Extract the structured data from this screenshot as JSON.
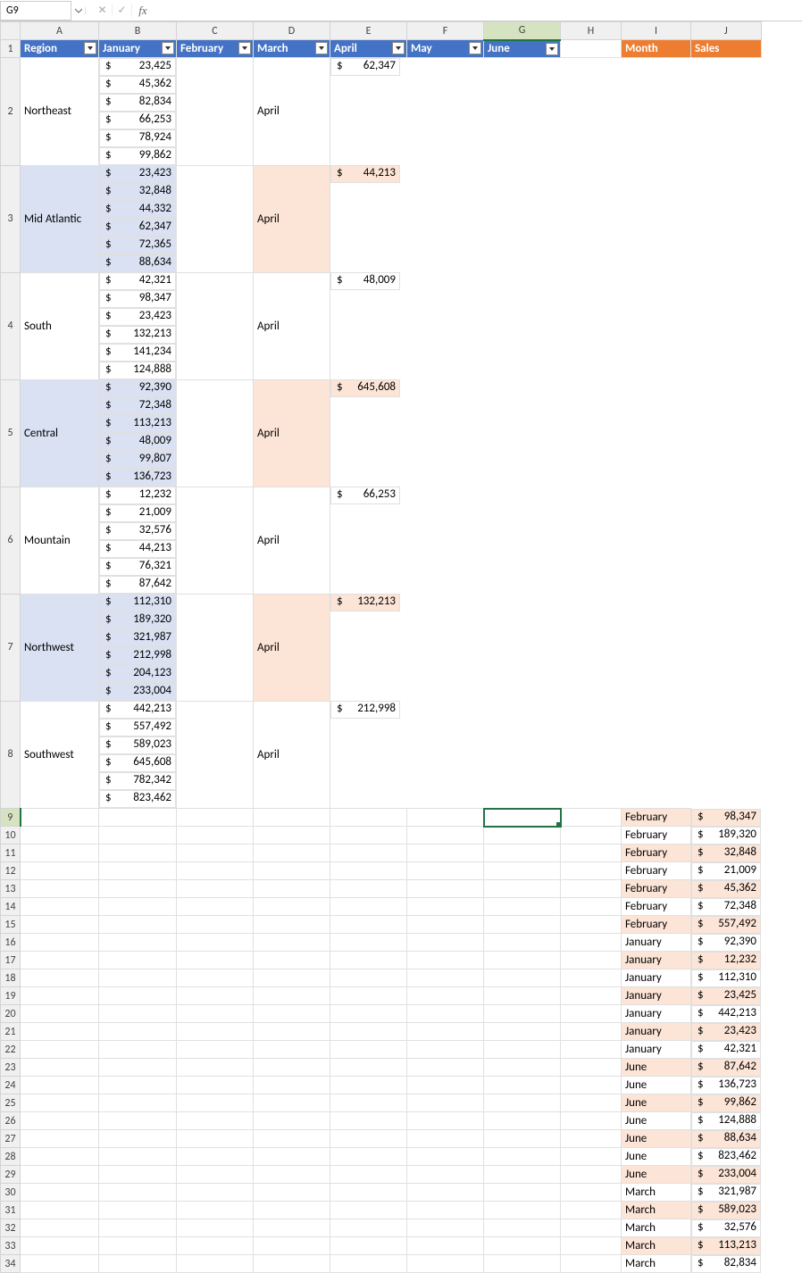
{
  "formula_bar": {
    "name_box": "G9",
    "fx_label": "fx",
    "formula": ""
  },
  "columns": [
    "A",
    "B",
    "C",
    "D",
    "E",
    "F",
    "G",
    "H",
    "I",
    "J"
  ],
  "row_count": 34,
  "selected_col": "G",
  "selected_row": 9,
  "table1": {
    "headers": [
      "Region",
      "January",
      "February",
      "March",
      "April",
      "May",
      "June"
    ],
    "rows": [
      {
        "region": "Northeast",
        "vals": [
          "23,425",
          "45,362",
          "82,834",
          "66,253",
          "78,924",
          "99,862"
        ]
      },
      {
        "region": "Mid Atlantic",
        "vals": [
          "23,423",
          "32,848",
          "44,332",
          "62,347",
          "72,365",
          "88,634"
        ]
      },
      {
        "region": "South",
        "vals": [
          "42,321",
          "98,347",
          "23,423",
          "132,213",
          "141,234",
          "124,888"
        ]
      },
      {
        "region": "Central",
        "vals": [
          "92,390",
          "72,348",
          "113,213",
          "48,009",
          "99,807",
          "136,723"
        ]
      },
      {
        "region": "Mountain",
        "vals": [
          "12,232",
          "21,009",
          "32,576",
          "44,213",
          "76,321",
          "87,642"
        ]
      },
      {
        "region": "Northwest",
        "vals": [
          "112,310",
          "189,320",
          "321,987",
          "212,998",
          "204,123",
          "233,004"
        ]
      },
      {
        "region": "Southwest",
        "vals": [
          "442,213",
          "557,492",
          "589,023",
          "645,608",
          "782,342",
          "823,462"
        ]
      }
    ]
  },
  "table2": {
    "headers": [
      "Month",
      "Sales"
    ],
    "rows": [
      {
        "month": "April",
        "sales": "62,347"
      },
      {
        "month": "April",
        "sales": "44,213"
      },
      {
        "month": "April",
        "sales": "48,009"
      },
      {
        "month": "April",
        "sales": "645,608"
      },
      {
        "month": "April",
        "sales": "66,253"
      },
      {
        "month": "April",
        "sales": "132,213"
      },
      {
        "month": "April",
        "sales": "212,998"
      },
      {
        "month": "February",
        "sales": "98,347"
      },
      {
        "month": "February",
        "sales": "189,320"
      },
      {
        "month": "February",
        "sales": "32,848"
      },
      {
        "month": "February",
        "sales": "21,009"
      },
      {
        "month": "February",
        "sales": "45,362"
      },
      {
        "month": "February",
        "sales": "72,348"
      },
      {
        "month": "February",
        "sales": "557,492"
      },
      {
        "month": "January",
        "sales": "92,390"
      },
      {
        "month": "January",
        "sales": "12,232"
      },
      {
        "month": "January",
        "sales": "112,310"
      },
      {
        "month": "January",
        "sales": "23,425"
      },
      {
        "month": "January",
        "sales": "442,213"
      },
      {
        "month": "January",
        "sales": "23,423"
      },
      {
        "month": "January",
        "sales": "42,321"
      },
      {
        "month": "June",
        "sales": "87,642"
      },
      {
        "month": "June",
        "sales": "136,723"
      },
      {
        "month": "June",
        "sales": "99,862"
      },
      {
        "month": "June",
        "sales": "124,888"
      },
      {
        "month": "June",
        "sales": "88,634"
      },
      {
        "month": "June",
        "sales": "823,462"
      },
      {
        "month": "June",
        "sales": "233,004"
      },
      {
        "month": "March",
        "sales": "321,987"
      },
      {
        "month": "March",
        "sales": "589,023"
      },
      {
        "month": "March",
        "sales": "32,576"
      },
      {
        "month": "March",
        "sales": "113,213"
      },
      {
        "month": "March",
        "sales": "82,834"
      }
    ]
  },
  "currency_symbol": "$"
}
